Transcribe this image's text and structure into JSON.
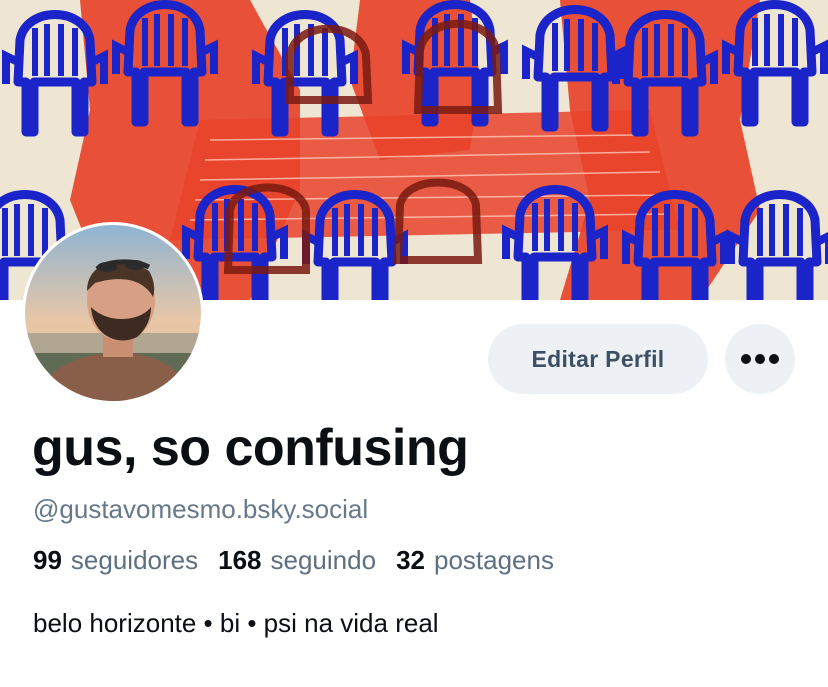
{
  "profile": {
    "display_name": "gus, so confusing",
    "handle": "@gustavomesmo.bsky.social",
    "bio": "belo horizonte • bi • psi na vida real"
  },
  "actions": {
    "edit_label": "Editar Perfil",
    "more_icon": "ellipsis-icon"
  },
  "stats": {
    "followers_count": "99",
    "followers_label": "seguidores",
    "following_count": "168",
    "following_label": "seguindo",
    "posts_count": "32",
    "posts_label": "postagens"
  },
  "colors": {
    "chair_blue": "#1a24c8",
    "table_red": "#e8432a",
    "banner_bg": "#efe5d3",
    "button_bg": "#edf1f5"
  }
}
